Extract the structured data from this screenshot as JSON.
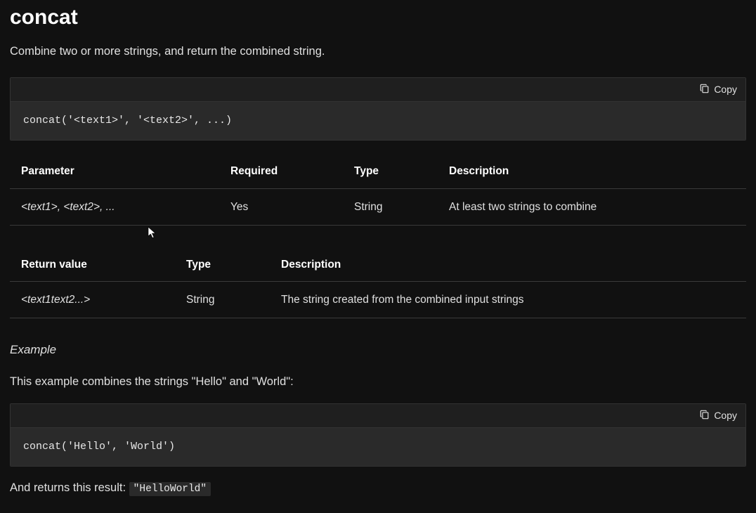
{
  "title": "concat",
  "description": "Combine two or more strings, and return the combined string.",
  "copy_label": "Copy",
  "code_syntax": "concat('<text1>', '<text2>', ...)",
  "param_table": {
    "headers": {
      "c1": "Parameter",
      "c2": "Required",
      "c3": "Type",
      "c4": "Description"
    },
    "row": {
      "c1": "<text1>, <text2>, ...",
      "c2": "Yes",
      "c3": "String",
      "c4": "At least two strings to combine"
    }
  },
  "return_table": {
    "headers": {
      "c1": "Return value",
      "c2": "Type",
      "c3": "Description"
    },
    "row": {
      "c1": "<text1text2...>",
      "c2": "String",
      "c3": "The string created from the combined input strings"
    }
  },
  "example": {
    "heading": "Example",
    "desc": "This example combines the strings \"Hello\" and \"World\":",
    "code": "concat('Hello', 'World')",
    "result_prefix": "And returns this result: ",
    "result_value": "\"HelloWorld\""
  }
}
